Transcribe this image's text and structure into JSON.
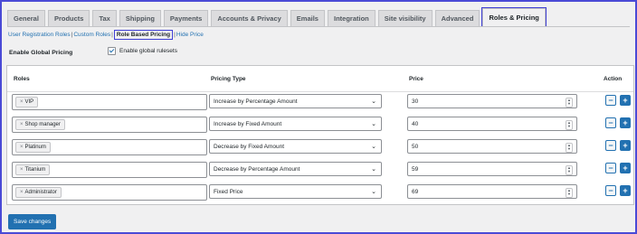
{
  "tabs": [
    "General",
    "Products",
    "Tax",
    "Shipping",
    "Payments",
    "Accounts & Privacy",
    "Emails",
    "Integration",
    "Site visibility",
    "Advanced",
    "Roles & Pricing"
  ],
  "active_tab": "Roles & Pricing",
  "subnav": {
    "items": [
      "User Registration Roles",
      "Custom Roles",
      "Role Based Pricing",
      "Hide Price"
    ],
    "current": "Role Based Pricing",
    "separator": "|"
  },
  "global": {
    "label": "Enable Global Pricing",
    "checkbox_label": "Enable global rulesets",
    "checked": true
  },
  "table": {
    "headers": {
      "roles": "Roles",
      "pricing_type": "Pricing Type",
      "price": "Price",
      "action": "Action"
    },
    "rows": [
      {
        "role": "VIP",
        "pricing_type": "Increase by Percentage Amount",
        "price": "30"
      },
      {
        "role": "Shop manager",
        "pricing_type": "Increase by Fixed Amount",
        "price": "40"
      },
      {
        "role": "Platinum",
        "pricing_type": "Decrease by Fixed Amount",
        "price": "50"
      },
      {
        "role": "Titanium",
        "pricing_type": "Decrease by Percentage Amount",
        "price": "59"
      },
      {
        "role": "Administrator",
        "pricing_type": "Fixed Price",
        "price": "69"
      }
    ],
    "remove_symbol": "−",
    "add_symbol": "+",
    "tag_remove_symbol": "×"
  },
  "save_label": "Save changes",
  "colors": {
    "accent": "#2271b1",
    "highlight_border": "#3f3fd4",
    "background": "#f0f0f1"
  },
  "icons": {
    "select_arrow": "chevron-down-icon",
    "spinner": "number-spinner-icon",
    "check": "checkmark-icon"
  }
}
